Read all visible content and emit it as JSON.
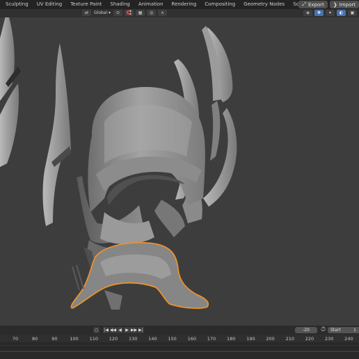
{
  "workspace_tabs": [
    "Sculpting",
    "UV Editing",
    "Texture Paint",
    "Shading",
    "Animation",
    "Rendering",
    "Compositing",
    "Geometry Nodes",
    "Scripting"
  ],
  "add_tab_label": "+",
  "top_right": {
    "export_label": "Export",
    "import_label": "Import"
  },
  "header": {
    "orientation_label": "Global",
    "snap_label": "▾"
  },
  "timeline": {
    "current_frame": "-20",
    "start_label": "Start",
    "start_value": "1",
    "ruler_ticks": [
      "70",
      "80",
      "90",
      "100",
      "110",
      "120",
      "130",
      "140",
      "150",
      "160",
      "170",
      "180",
      "190",
      "200",
      "210",
      "220",
      "230",
      "240"
    ]
  },
  "colors": {
    "viewport_bg": "#3d3d3d",
    "selection_outline": "#e8932d",
    "mesh_base": "#8f8f8f",
    "active_button": "#4772b3"
  }
}
